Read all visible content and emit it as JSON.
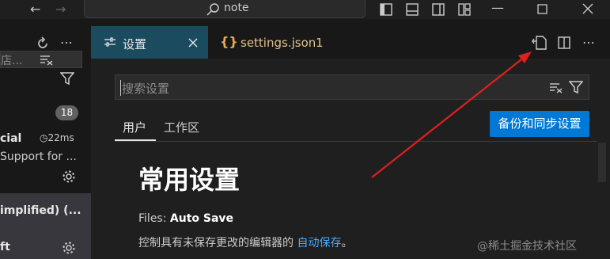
{
  "titlebar": {
    "search_text": "note"
  },
  "sidebar": {
    "filter_text": "店...",
    "badge_count": "18",
    "item1_title": "cial",
    "item1_time": "22ms",
    "item1_desc": "Support for ...",
    "item2_title": "implified) (...",
    "item2_sub": "ft"
  },
  "tabs": [
    {
      "label": "设置"
    },
    {
      "label": "settings.json",
      "badge": "1"
    }
  ],
  "settings": {
    "search_placeholder": "搜索设置",
    "scope_tabs": [
      "用户",
      "工作区"
    ],
    "sync_button": "备份和同步设置",
    "section_heading": "常用设置",
    "setting_label_prefix": "Files: ",
    "setting_label_name": "Auto Save",
    "setting_desc": "控制具有未保存更改的编辑器的",
    "setting_desc_link": "自动保存",
    "setting_desc_suffix": "。"
  },
  "watermark": "@稀土掘金技术社区",
  "colors": {
    "accent": "#0078d4",
    "active_tab": "#1b4b5f",
    "json_tab": "#e2c08d",
    "arrow": "#e0201c"
  }
}
